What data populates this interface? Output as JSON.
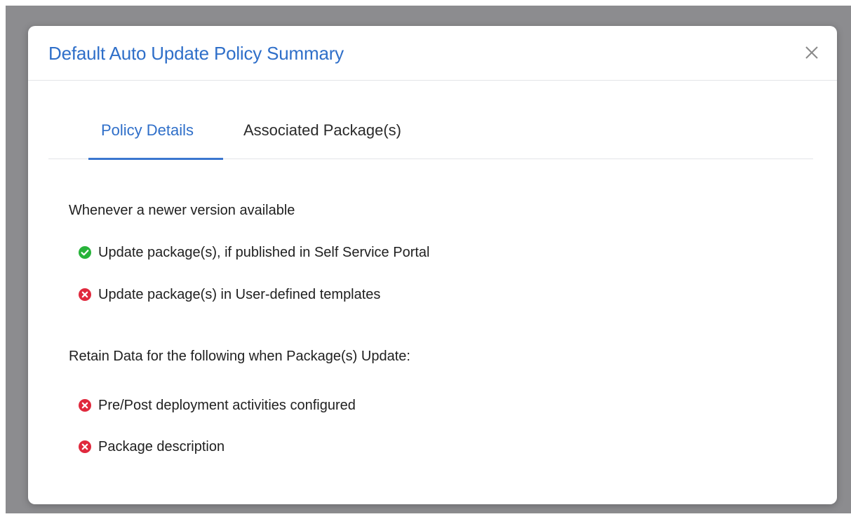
{
  "dialog": {
    "title": "Default Auto Update Policy Summary",
    "close_icon": "close-icon"
  },
  "tabs": [
    {
      "label": "Policy Details",
      "active": true
    },
    {
      "label": "Associated Package(s)",
      "active": false
    }
  ],
  "sections": [
    {
      "heading": "Whenever a newer version available",
      "items": [
        {
          "label": "Update package(s), if published in Self Service Portal",
          "status": "enabled",
          "icon": "check-circle-icon"
        },
        {
          "label": "Update package(s) in User-defined templates",
          "status": "disabled",
          "icon": "x-circle-icon"
        }
      ]
    },
    {
      "heading": "Retain Data for the following when Package(s) Update:",
      "items": [
        {
          "label": "Pre/Post deployment activities configured",
          "status": "disabled",
          "icon": "x-circle-icon"
        },
        {
          "label": "Package description",
          "status": "disabled",
          "icon": "x-circle-icon"
        }
      ]
    }
  ],
  "colors": {
    "accent": "#2f6fc9",
    "enabled": "#27b33a",
    "disabled": "#e0293d",
    "backdrop": "#8c8c8f"
  }
}
